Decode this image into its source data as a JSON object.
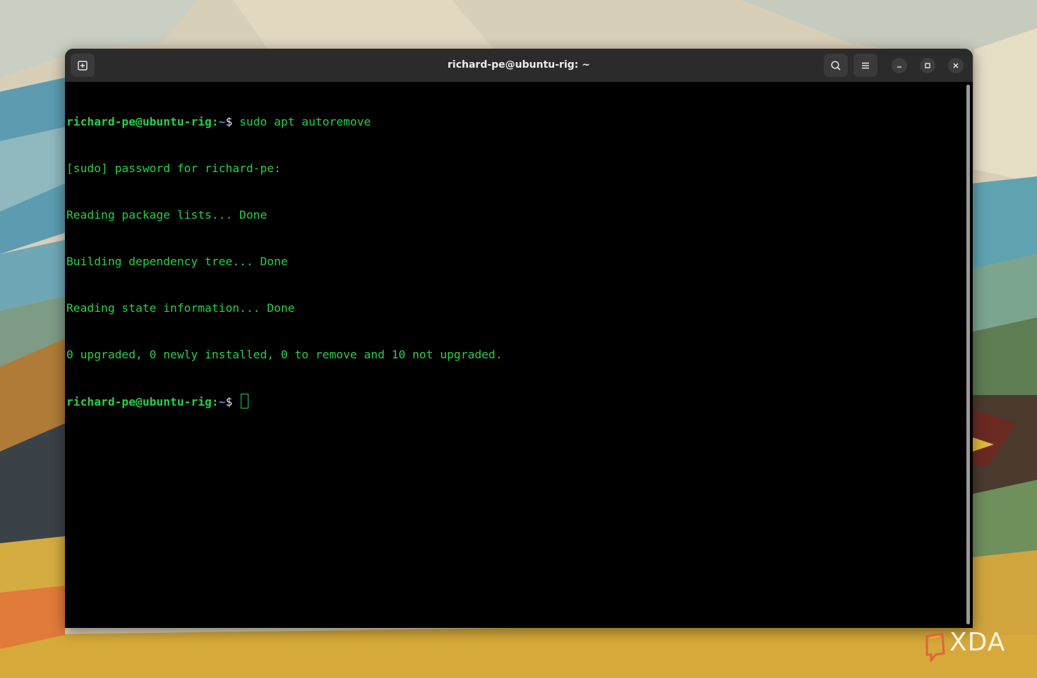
{
  "window": {
    "title": "richard-pe@ubuntu-rig: ~"
  },
  "headerbar": {
    "new_tab_icon": "new-tab-icon",
    "search_icon": "search-icon",
    "menu_icon": "hamburger-menu-icon",
    "minimize_icon": "minimize-icon",
    "maximize_icon": "maximize-icon",
    "close_icon": "close-icon"
  },
  "terminal": {
    "prompt_user": "richard-pe@ubuntu-rig:",
    "prompt_path": "~",
    "prompt_symbol": "$",
    "lines": [
      {
        "type": "prompt",
        "command": " sudo apt autoremove"
      },
      {
        "type": "output",
        "text": "[sudo] password for richard-pe:"
      },
      {
        "type": "output",
        "text": "Reading package lists... Done"
      },
      {
        "type": "output",
        "text": "Building dependency tree... Done"
      },
      {
        "type": "output",
        "text": "Reading state information... Done"
      },
      {
        "type": "output",
        "text": "0 upgraded, 0 newly installed, 0 to remove and 10 not upgraded."
      },
      {
        "type": "prompt",
        "command": " "
      }
    ]
  },
  "colors": {
    "terminal_bg": "#000000",
    "text_green": "#26d046",
    "path_blue": "#3e8fe0",
    "headerbar_bg": "#2b2b2b"
  },
  "watermark": {
    "text": "XDA"
  }
}
